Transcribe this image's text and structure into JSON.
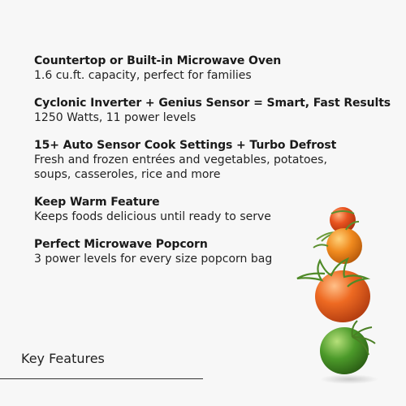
{
  "features": [
    {
      "title": "Countertop or Built-in Microwave Oven",
      "lines": [
        "1.6 cu.ft. capacity, perfect for families"
      ]
    },
    {
      "title": "Cyclonic Inverter + Genius Sensor = Smart, Fast Results",
      "lines": [
        "1250 Watts, 11 power levels"
      ]
    },
    {
      "title": "15+ Auto Sensor Cook Settings + Turbo Defrost",
      "lines": [
        "Fresh and frozen entrées and vegetables, potatoes,",
        "soups, casseroles, rice and more"
      ]
    },
    {
      "title": "Keep Warm Feature",
      "lines": [
        "Keeps foods delicious until ready to serve"
      ]
    },
    {
      "title": "Perfect Microwave Popcorn",
      "lines": [
        "3 power levels for every size popcorn bag"
      ]
    }
  ],
  "footer": {
    "label": "Key Features"
  },
  "colors": {
    "background": "#f7f7f7",
    "tomato_red": "#e8531f",
    "tomato_orange": "#f08a1e",
    "tomato_green": "#4c9a2a",
    "stem_green": "#5a8f2e"
  },
  "image": {
    "subject": "cherry-tomatoes-icon"
  }
}
